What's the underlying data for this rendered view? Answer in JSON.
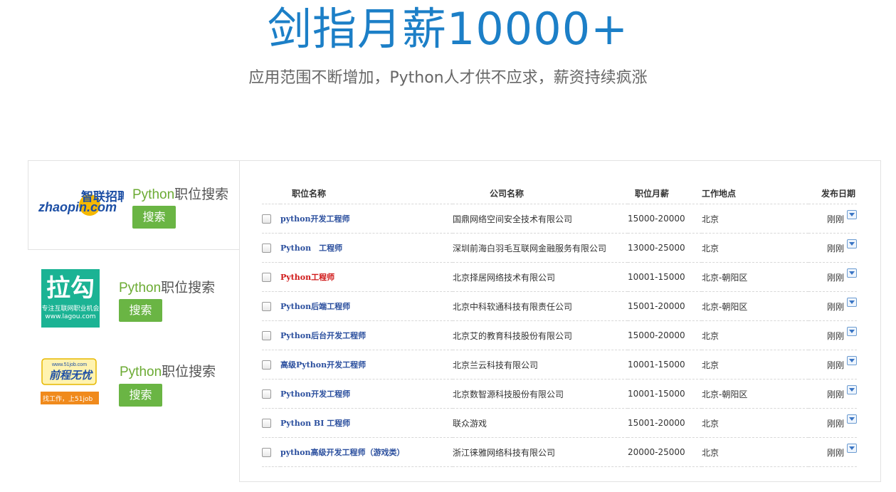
{
  "hero": {
    "title": "剑指月薪10000+",
    "subtitle": "应用范围不断增加，Python人才供不应求，薪资持续疯涨"
  },
  "sites": [
    {
      "logo_icon": "zhaopin-logo",
      "logo_text_cn": "智联招聘",
      "logo_text_en": "zhaopin.com",
      "label_en": "Python",
      "label_cn": "职位搜索",
      "button": "搜索"
    },
    {
      "logo_icon": "lagou-logo",
      "logo_text_cn": "拉勾",
      "logo_sub1": "专注互联网职业机会",
      "logo_sub2": "www.lagou.com",
      "label_en": "Python",
      "label_cn": "职位搜索",
      "button": "搜索"
    },
    {
      "logo_icon": "51job-logo",
      "logo_url": "www.51job.com",
      "logo_text_cn": "前程无忧",
      "logo_banner": "找工作，上51job",
      "label_en": "Python",
      "label_cn": "职位搜索",
      "button": "搜索"
    }
  ],
  "table": {
    "headers": [
      "职位名称",
      "公司名称",
      "职位月薪",
      "工作地点",
      "发布日期"
    ],
    "rows": [
      {
        "title": "python开发工程师",
        "company": "国鼎网络空间安全技术有限公司",
        "salary": "15000-20000",
        "location": "北京",
        "date": "刚刚",
        "highlight": false
      },
      {
        "title": "Python　工程师",
        "company": "深圳前海白羽毛互联网金融服务有限公司",
        "salary": "13000-25000",
        "location": "北京",
        "date": "刚刚",
        "highlight": false
      },
      {
        "title": "Python工程师",
        "company": "北京择居网络技术有限公司",
        "salary": "10001-15000",
        "location": "北京-朝阳区",
        "date": "刚刚",
        "highlight": true
      },
      {
        "title": "Python后端工程师",
        "company": "北京中科软通科技有限责任公司",
        "salary": "15001-20000",
        "location": "北京-朝阳区",
        "date": "刚刚",
        "highlight": false
      },
      {
        "title": "Python后台开发工程师",
        "company": "北京艾的教育科技股份有限公司",
        "salary": "15000-20000",
        "location": "北京",
        "date": "刚刚",
        "highlight": false
      },
      {
        "title": "高级Python开发工程师",
        "company": "北京兰云科技有限公司",
        "salary": "10001-15000",
        "location": "北京",
        "date": "刚刚",
        "highlight": false
      },
      {
        "title": "Python开发工程师",
        "company": "北京数智源科技股份有限公司",
        "salary": "10001-15000",
        "location": "北京-朝阳区",
        "date": "刚刚",
        "highlight": false
      },
      {
        "title": "Python BI 工程师",
        "company": "联众游戏",
        "salary": "15001-20000",
        "location": "北京",
        "date": "刚刚",
        "highlight": false
      },
      {
        "title": "python高级开发工程师（游戏类）",
        "company": "浙江徕雅网络科技有限公司",
        "salary": "20000-25000",
        "location": "北京",
        "date": "刚刚",
        "highlight": false
      }
    ]
  },
  "colors": {
    "accent": "#1c7fc7",
    "button": "#6ab544",
    "label_green": "#6cab34",
    "link": "#2b4f9e",
    "link_highlight": "#d01919"
  },
  "icons": {
    "checkbox": "checkbox-icon",
    "dropdown": "dropdown-arrow-icon"
  }
}
